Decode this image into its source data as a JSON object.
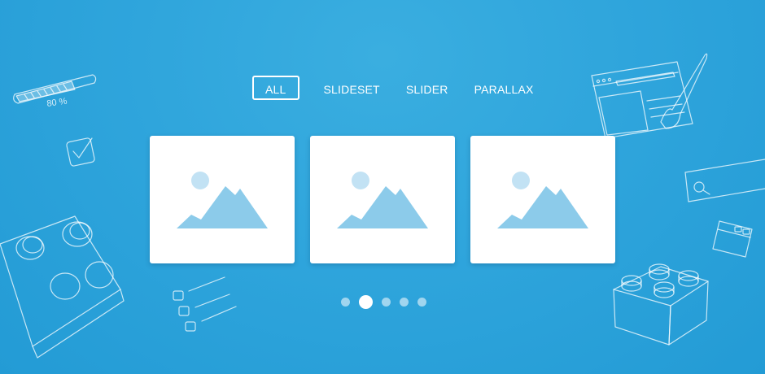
{
  "filters": [
    {
      "label": "ALL",
      "active": true
    },
    {
      "label": "SLIDESET",
      "active": false
    },
    {
      "label": "SLIDER",
      "active": false
    },
    {
      "label": "PARALLAX",
      "active": false
    }
  ],
  "decorations": {
    "progress_label": "80 %"
  },
  "gallery": {
    "items": [
      {
        "icon": "image-placeholder-icon"
      },
      {
        "icon": "image-placeholder-icon"
      },
      {
        "icon": "image-placeholder-icon"
      }
    ]
  },
  "pagination": {
    "count": 5,
    "active_index": 1
  },
  "colors": {
    "background": "#2fa5dc",
    "placeholder": "#8ccbea",
    "card": "#ffffff"
  }
}
